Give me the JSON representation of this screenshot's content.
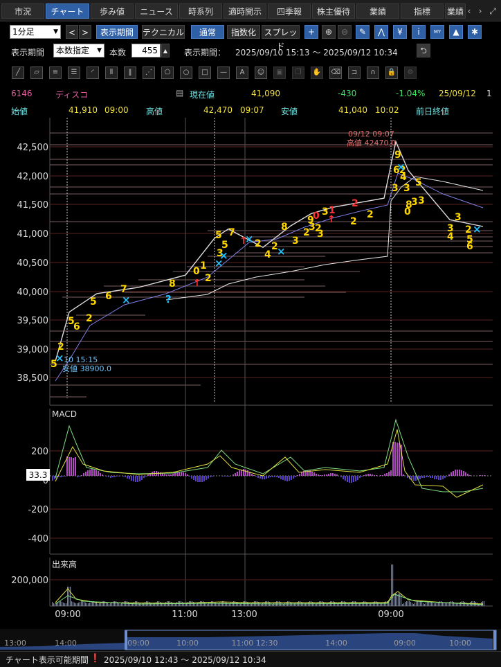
{
  "tabs": {
    "items": [
      "市況",
      "チャート",
      "歩み値",
      "ニュース",
      "時系列",
      "適時開示",
      "四季報",
      "株主優待",
      "業績",
      "指標",
      "業績"
    ],
    "active_index": 1,
    "prev_icon": "chevron-left-icon",
    "next_icon": "chevron-right-icon",
    "expand_icon": "expand-icon"
  },
  "toolbar1": {
    "interval_value": "1分足",
    "prev_label": "<",
    "next_label": ">",
    "period_button": "表示期間",
    "technical_button": "テクニカル",
    "normal_button": "通常",
    "index_button": "指数化",
    "spread_button": "スプレッド",
    "icons": [
      "plus-icon",
      "zoom-in-icon",
      "zoom-out-icon",
      "pen-icon",
      "pattern-icon",
      "yen-icon",
      "info-icon",
      "my-icon",
      "area-chart-icon",
      "wrench-icon"
    ]
  },
  "toolbar2": {
    "period_label": "表示期間",
    "period_mode": "本数指定",
    "count_label": "本数",
    "count_value": "455",
    "range_label": "表示期間：",
    "range_value": "2025/09/10 15:13 ～ 2025/09/12 10:34",
    "refresh_icon": "return-icon"
  },
  "drawing_tools": [
    "line-tool-icon",
    "ruler-tool-icon",
    "hlines-tool-icon",
    "hlines2-tool-icon",
    "fan-tool-icon",
    "vlines-tool-icon",
    "fan2-tool-icon",
    "pentagon-tool-icon",
    "circle-tool-icon",
    "rect-tool-icon",
    "hline-tool-icon",
    "text-tool-icon",
    "icon-tool-icon",
    "cube-tool-icon",
    "copy-tool-icon",
    "hand-tool-icon",
    "eraser-tool-icon",
    "magnet-tool-icon",
    "magnet2-tool-icon",
    "lock-tool-icon",
    "gear-tool-icon"
  ],
  "quote": {
    "code": "6146",
    "name": "ディスコ",
    "current_label": "現在値",
    "current": "41,090",
    "change": "-430",
    "change_pct": "-1.04%",
    "date": "25/09/12",
    "open_label": "始値",
    "open": "41,910",
    "open_time": "09:00",
    "high_label": "高値",
    "high": "42,470",
    "high_time": "09:07",
    "low_label": "安値",
    "low": "41,040",
    "low_time": "10:02",
    "prev_close_label": "前日終値"
  },
  "chart": {
    "price_ticks": [
      "42,500",
      "42,000",
      "41,500",
      "41,000",
      "40,500",
      "40,000",
      "39,500",
      "39,000",
      "38,500"
    ],
    "high_annotation": "09/12 09:07",
    "high_annotation2": "高値 42470.0",
    "low_annotation": "10 15:15",
    "low_annotation2": "安値 38900.0",
    "macd_label": "MACD",
    "macd_ticks": [
      "200",
      "0",
      "-200",
      "-400"
    ],
    "macd_value": "33.3",
    "volume_label": "出来高",
    "volume_ticks": [
      "200,000"
    ],
    "time_ticks": [
      "09:00",
      "11:00",
      "13:00",
      "09:00"
    ],
    "colors": {
      "price": "#d8d8d8",
      "ma_short": "#8a8ae0",
      "ma_long": "#e0e0e0",
      "macd": "#e0e040",
      "signal": "#80e080",
      "hist": "#b04cc0",
      "marker": "#ffd700",
      "signal_up": "#ff2020",
      "signal_x": "#20c0ff"
    }
  },
  "chart_data": {
    "type": "line",
    "title": "",
    "series": [
      {
        "name": "",
        "values": [
          38900,
          39700,
          40000,
          40100,
          40300,
          40900,
          41050,
          40750,
          41100,
          41300,
          41400,
          41480,
          41550,
          42470,
          42000,
          41600,
          41200,
          41090
        ]
      }
    ],
    "x": [
      "15:13",
      "09:10",
      "09:40",
      "10:20",
      "11:00",
      "11:30",
      "12:40",
      "13:30",
      "14:00",
      "14:20",
      "14:40",
      "15:00",
      "15:20",
      "09:07",
      "09:20",
      "09:40",
      "10:10",
      "10:34"
    ],
    "ylim": [
      38300,
      42800
    ],
    "grid": true
  },
  "navigator": {
    "ticks": [
      "13:00",
      "14:00",
      "09:00",
      "10:00",
      "11:00 12:30",
      "14:00",
      "09:00",
      "10:00"
    ]
  },
  "footer": {
    "label": "チャート表示可能期間",
    "range": "2025/09/10 12:43 ～ 2025/09/12 10:34",
    "warn_icon": "warning-icon"
  }
}
